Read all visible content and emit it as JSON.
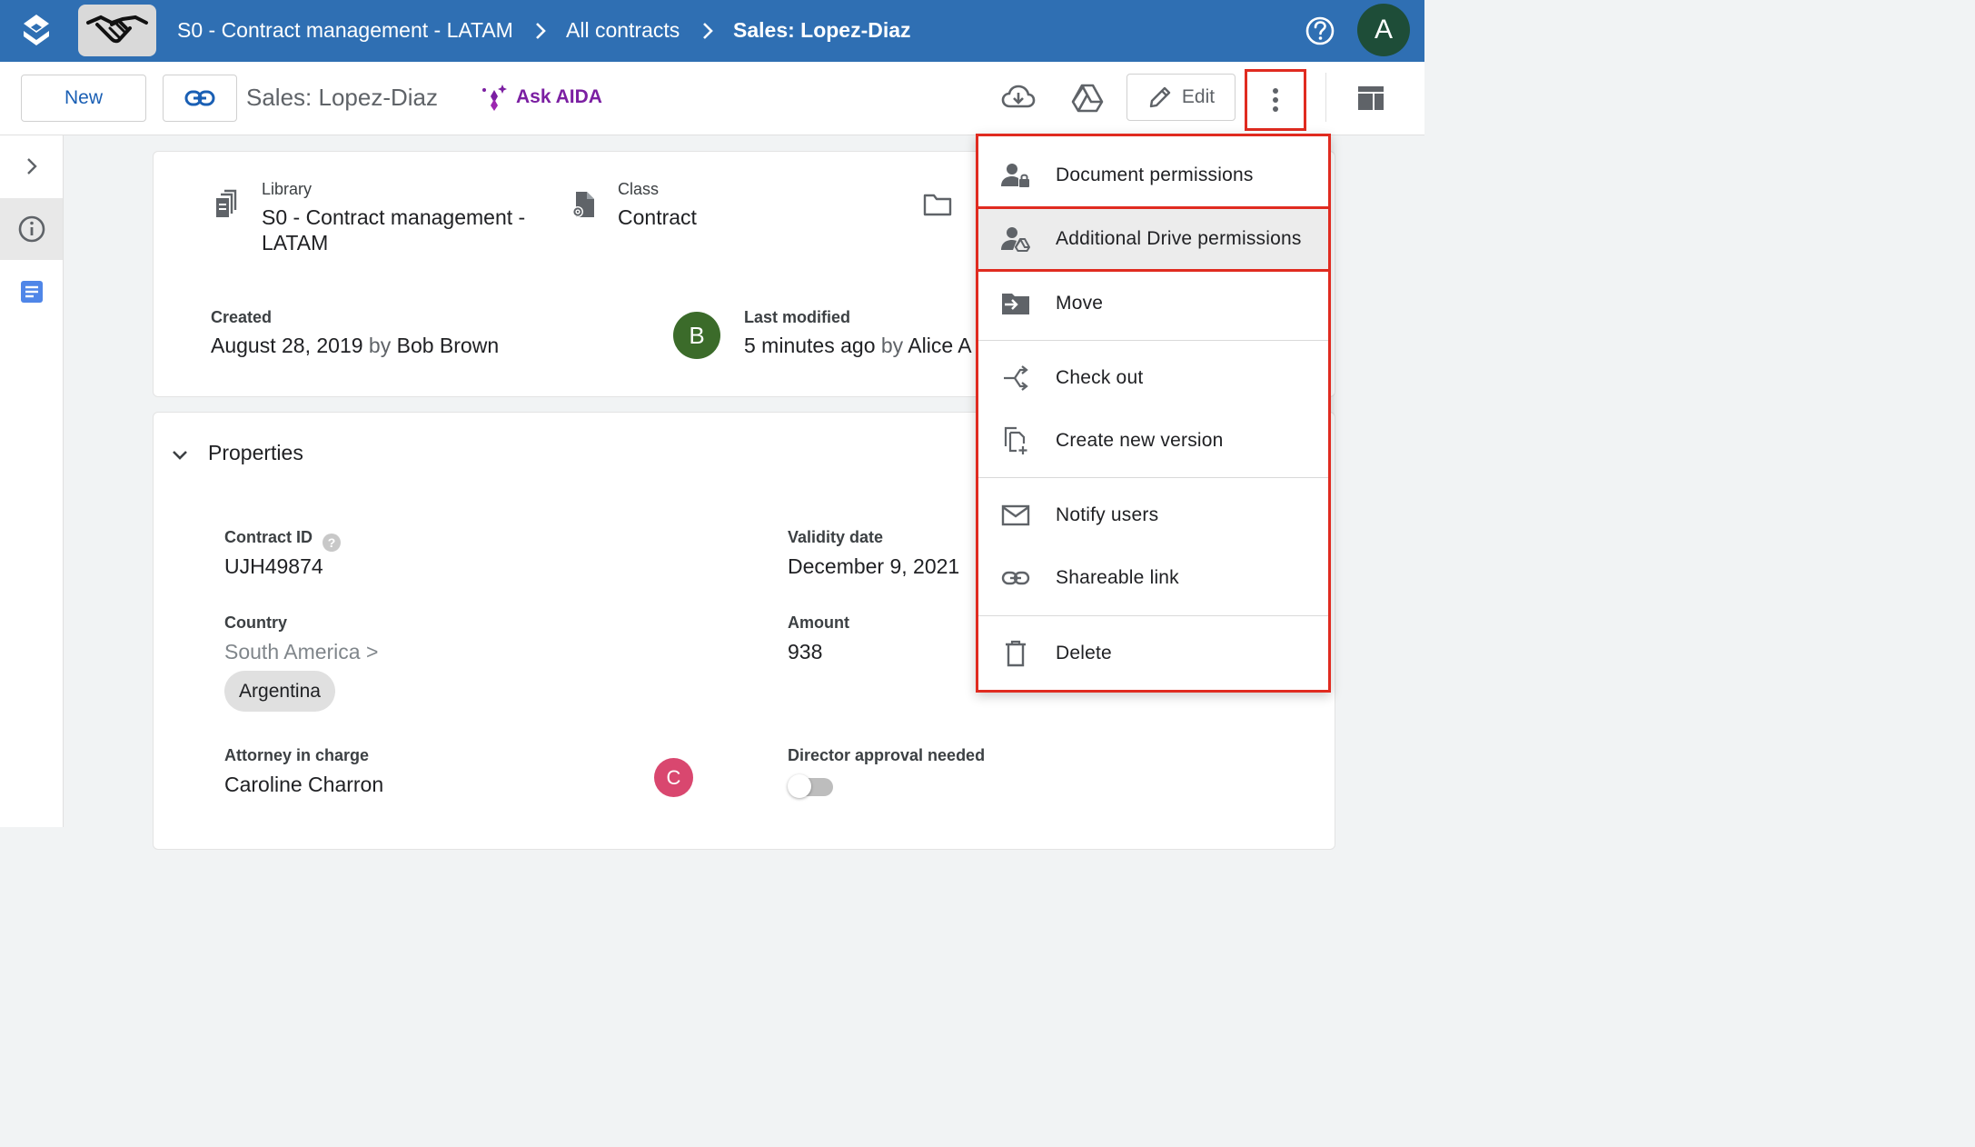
{
  "topbar": {
    "breadcrumb": [
      "S0 - Contract management - LATAM",
      "All contracts",
      "Sales: Lopez-Diaz"
    ],
    "avatar_initial": "A",
    "brand_color": "#2f6fb3"
  },
  "toolbar": {
    "new_label": "New",
    "doc_title": "Sales: Lopez-Diaz",
    "ask_aida_label": "Ask AIDA",
    "edit_label": "Edit"
  },
  "info": {
    "library_label": "Library",
    "library_value": "S0 - Contract management - LATAM",
    "class_label": "Class",
    "class_value": "Contract",
    "created_label": "Created",
    "created_date": "August 28, 2019",
    "by_word": "by",
    "created_by": "Bob Brown",
    "created_avatar_initial": "B",
    "modified_label": "Last modified",
    "modified_date": "5 minutes ago",
    "modified_by": "Alice A"
  },
  "properties": {
    "title": "Properties",
    "contract_id_label": "Contract ID",
    "contract_id_help": "?",
    "contract_id": "UJH49874",
    "validity_label": "Validity date",
    "validity_value": "December 9, 2021",
    "country_label": "Country",
    "country_path": "South America >",
    "country_chip": "Argentina",
    "amount_label": "Amount",
    "amount_value": "938",
    "attorney_label": "Attorney in charge",
    "attorney_value": "Caroline Charron",
    "attorney_avatar_initial": "C",
    "director_label": "Director approval needed",
    "director_approval_on": false
  },
  "menu": {
    "items": [
      {
        "label": "Document permissions",
        "icon": "person-lock-icon"
      },
      {
        "label": "Additional Drive permissions",
        "icon": "person-drive-icon"
      },
      {
        "label": "Move",
        "icon": "folder-move-icon"
      },
      {
        "label": "Check out",
        "icon": "check-out-icon"
      },
      {
        "label": "Create new version",
        "icon": "new-version-icon"
      },
      {
        "label": "Notify users",
        "icon": "mail-icon"
      },
      {
        "label": "Shareable link",
        "icon": "link-icon"
      },
      {
        "label": "Delete",
        "icon": "trash-icon"
      }
    ]
  },
  "colors": {
    "accent": "#2f6fb3",
    "highlight_border": "#e02b20",
    "aida_purple": "#7b1fa2"
  }
}
